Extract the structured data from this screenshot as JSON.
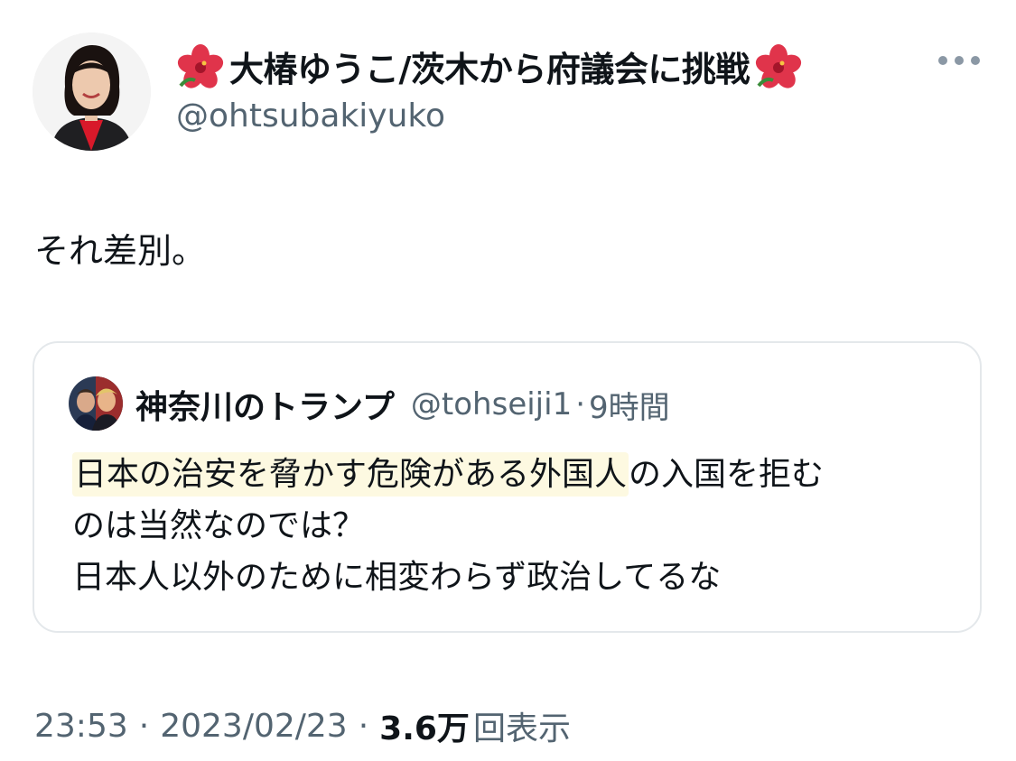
{
  "tweet": {
    "author": {
      "display_name": "大椿ゆうこ/茨木から府議会に挑戦",
      "handle": "@ohtsubakiyuko",
      "name_emoji_icon": "hibiscus-icon"
    },
    "more_icon": "more-options-icon",
    "text": "それ差別。",
    "quoted": {
      "author_name": "神奈川のトランプ",
      "handle": "@tohseiji1",
      "separator": "·",
      "time_ago": "9時間",
      "text_highlight": "日本の治安を脅かす危険がある外国人",
      "text_line1_rest": "の入国を拒む",
      "text_line2": "のは当然なのでは？",
      "text_line3": "日本人以外のために相変わらず政治してるな"
    },
    "meta": {
      "time": "23:53",
      "separator": "·",
      "date": "2023/02/23",
      "views_count": "3.6万",
      "views_label": "回表示"
    }
  },
  "colors": {
    "text_primary": "#0f1419",
    "text_secondary": "#536471",
    "card_border": "#e4e8eb",
    "highlight": "#fdf9e1",
    "hibiscus": "#e0344b"
  }
}
